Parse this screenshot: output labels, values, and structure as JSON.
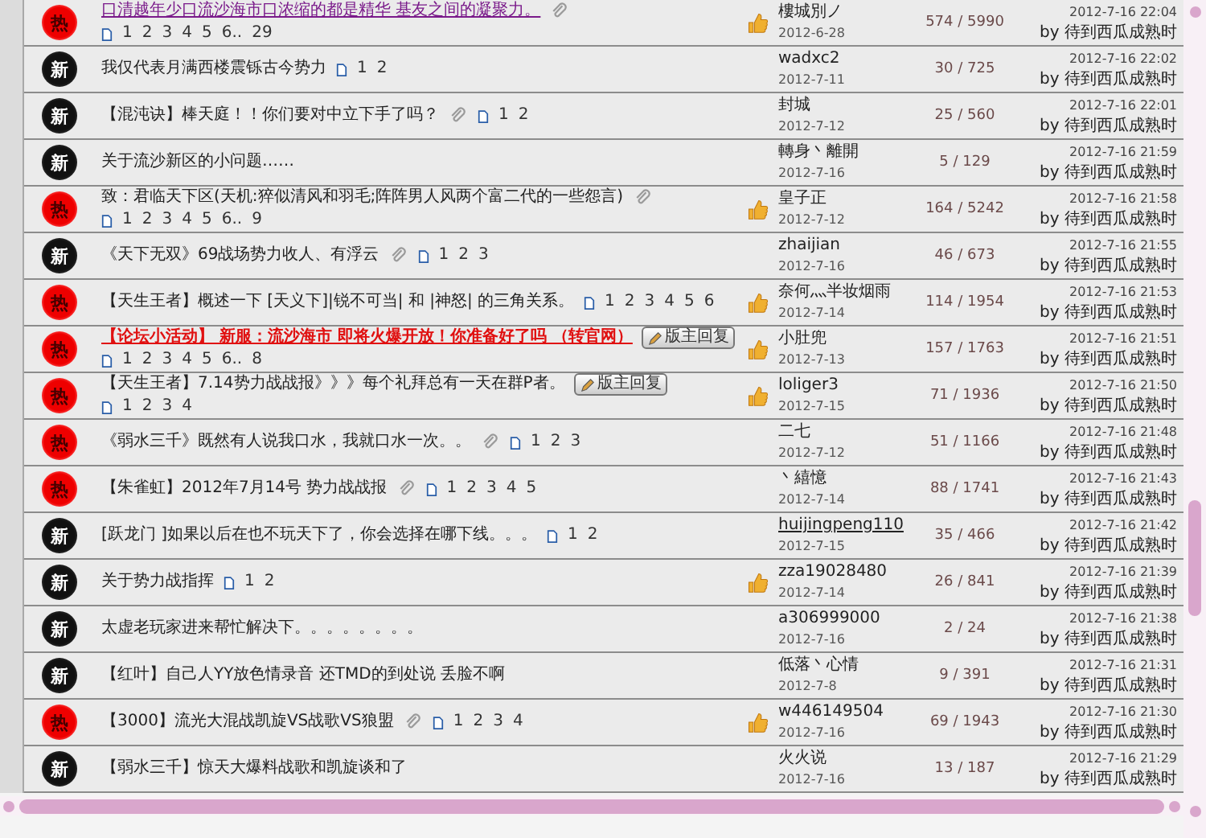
{
  "topics": [
    {
      "kind": "hot",
      "badge": "热",
      "title": "口清越年少口流沙海市口浓缩的都是精华 基友之间的凝聚力。",
      "visited": true,
      "highlighted": false,
      "attachment": true,
      "pages": [
        "1",
        "2",
        "3",
        "4",
        "5",
        "6..",
        "29"
      ],
      "liked": true,
      "author": "樓城別ノ",
      "date": "2012-6-28",
      "counts": "574 / 5990",
      "last_time": "2012-7-16 22:04",
      "last_by": "by 待到西瓜成熟时"
    },
    {
      "kind": "new",
      "badge": "新",
      "title": "我仅代表月满西楼震铄古今势力",
      "visited": false,
      "highlighted": false,
      "attachment": false,
      "pages": [
        "1",
        "2"
      ],
      "liked": false,
      "author": "wadxc2",
      "date": "2012-7-11",
      "counts": "30 / 725",
      "last_time": "2012-7-16 22:02",
      "last_by": "by 待到西瓜成熟时"
    },
    {
      "kind": "new",
      "badge": "新",
      "title": "【混沌诀】棒天庭！！你们要对中立下手了吗？",
      "visited": false,
      "highlighted": false,
      "attachment": true,
      "pages": [
        "1",
        "2"
      ],
      "liked": false,
      "author": "封城",
      "date": "2012-7-12",
      "counts": "25 / 560",
      "last_time": "2012-7-16 22:01",
      "last_by": "by 待到西瓜成熟时"
    },
    {
      "kind": "new",
      "badge": "新",
      "title": "关于流沙新区的小问题……",
      "visited": false,
      "highlighted": false,
      "attachment": false,
      "liked": false,
      "author": "轉身丶離開",
      "date": "2012-7-16",
      "counts": "5 / 129",
      "last_time": "2012-7-16 21:59",
      "last_by": "by 待到西瓜成熟时"
    },
    {
      "kind": "hot",
      "badge": "热",
      "title": "致：君临天下区(天机:猝似清风和羽毛;阵阵男人风两个富二代的一些怨言)",
      "visited": false,
      "highlighted": false,
      "attachment": true,
      "pages": [
        "1",
        "2",
        "3",
        "4",
        "5",
        "6..",
        "9"
      ],
      "liked": true,
      "author": "皇子正",
      "date": "2012-7-12",
      "counts": "164 / 5242",
      "last_time": "2012-7-16 21:58",
      "last_by": "by 待到西瓜成熟时"
    },
    {
      "kind": "new",
      "badge": "新",
      "title": "《天下无双》69战场势力收人、有浮云",
      "visited": false,
      "highlighted": false,
      "attachment": true,
      "pages": [
        "1",
        "2",
        "3"
      ],
      "liked": false,
      "author": "zhaijian",
      "date": "2012-7-16",
      "counts": "46 / 673",
      "last_time": "2012-7-16 21:55",
      "last_by": "by 待到西瓜成熟时"
    },
    {
      "kind": "hot",
      "badge": "热",
      "title": "【天生王者】概述一下 [天义下]|锐不可当| 和 |神怒| 的三角关系。",
      "visited": false,
      "highlighted": false,
      "attachment": false,
      "pages": [
        "1",
        "2",
        "3",
        "4",
        "5",
        "6"
      ],
      "liked": true,
      "author": "奈何灬半妆烟雨",
      "date": "2012-7-14",
      "counts": "114 / 1954",
      "last_time": "2012-7-16 21:53",
      "last_by": "by 待到西瓜成熟时"
    },
    {
      "kind": "hot",
      "badge": "热",
      "title": "【论坛小活动】 新服：流沙海市 即将火爆开放！你准备好了吗 （转官网）",
      "visited": false,
      "highlighted": true,
      "attachment": false,
      "mod_tag": "版主回复",
      "pages": [
        "1",
        "2",
        "3",
        "4",
        "5",
        "6..",
        "8"
      ],
      "liked": true,
      "author": "小肚兜",
      "date": "2012-7-13",
      "counts": "157 / 1763",
      "last_time": "2012-7-16 21:51",
      "last_by": "by 待到西瓜成熟时"
    },
    {
      "kind": "hot",
      "badge": "热",
      "title": "【天生王者】7.14势力战战报》》》每个礼拜总有一天在群P者。",
      "visited": false,
      "highlighted": false,
      "attachment": false,
      "mod_tag": "版主回复",
      "pages": [
        "1",
        "2",
        "3",
        "4"
      ],
      "liked": true,
      "author": "loliger3",
      "date": "2012-7-15",
      "counts": "71 / 1936",
      "last_time": "2012-7-16 21:50",
      "last_by": "by 待到西瓜成熟时"
    },
    {
      "kind": "hot",
      "badge": "热",
      "title": "《弱水三千》既然有人说我口水，我就口水一次。。",
      "visited": false,
      "highlighted": false,
      "attachment": true,
      "pages": [
        "1",
        "2",
        "3"
      ],
      "liked": false,
      "author": "二七",
      "date": "2012-7-12",
      "counts": "51 / 1166",
      "last_time": "2012-7-16 21:48",
      "last_by": "by 待到西瓜成熟时"
    },
    {
      "kind": "hot",
      "badge": "热",
      "title": "【朱雀虹】2012年7月14号 势力战战报",
      "visited": false,
      "highlighted": false,
      "attachment": true,
      "pages": [
        "1",
        "2",
        "3",
        "4",
        "5"
      ],
      "liked": false,
      "author": "丶繥憶",
      "date": "2012-7-14",
      "counts": "88 / 1741",
      "last_time": "2012-7-16 21:43",
      "last_by": "by 待到西瓜成熟时"
    },
    {
      "kind": "new",
      "badge": "新",
      "title": "[跃龙门 ]如果以后在也不玩天下了，你会选择在哪下线。。。",
      "visited": false,
      "highlighted": false,
      "attachment": false,
      "pages": [
        "1",
        "2"
      ],
      "liked": false,
      "author": "huijingpeng110",
      "date": "2012-7-15",
      "counts": "35 / 466",
      "last_time": "2012-7-16 21:42",
      "last_by": "by 待到西瓜成熟时"
    },
    {
      "kind": "new",
      "badge": "新",
      "title": "关于势力战指挥",
      "visited": false,
      "highlighted": false,
      "attachment": false,
      "pages": [
        "1",
        "2"
      ],
      "liked": true,
      "author": "zza19028480",
      "date": "2012-7-14",
      "counts": "26 / 841",
      "last_time": "2012-7-16 21:39",
      "last_by": "by 待到西瓜成熟时"
    },
    {
      "kind": "new",
      "badge": "新",
      "title": "太虚老玩家进来帮忙解决下。。。。。。。。",
      "visited": false,
      "highlighted": false,
      "attachment": false,
      "liked": false,
      "author": "a306999000",
      "date": "2012-7-16",
      "counts": "2 / 24",
      "last_time": "2012-7-16 21:38",
      "last_by": "by 待到西瓜成熟时"
    },
    {
      "kind": "new",
      "badge": "新",
      "title": "【红叶】自己人YY放色情录音 还TMD的到处说 丢脸不啊",
      "visited": false,
      "highlighted": false,
      "attachment": false,
      "liked": false,
      "author": "低落丶心情",
      "date": "2012-7-8",
      "counts": "9 / 391",
      "last_time": "2012-7-16 21:31",
      "last_by": "by 待到西瓜成熟时"
    },
    {
      "kind": "hot",
      "badge": "热",
      "title": "【3000】流光大混战凯旋VS战歌VS狼盟",
      "visited": false,
      "highlighted": false,
      "attachment": true,
      "pages": [
        "1",
        "2",
        "3",
        "4"
      ],
      "liked": true,
      "author": "w446149504",
      "date": "2012-7-16",
      "counts": "69 / 1943",
      "last_time": "2012-7-16 21:30",
      "last_by": "by 待到西瓜成熟时"
    },
    {
      "kind": "new",
      "badge": "新",
      "title": "【弱水三千】惊天大爆料战歌和凯旋谈和了",
      "visited": false,
      "highlighted": false,
      "attachment": false,
      "liked": false,
      "author": "火火说",
      "date": "2012-7-16",
      "counts": "13 / 187",
      "last_time": "2012-7-16 21:29",
      "last_by": "by 待到西瓜成熟时"
    }
  ]
}
